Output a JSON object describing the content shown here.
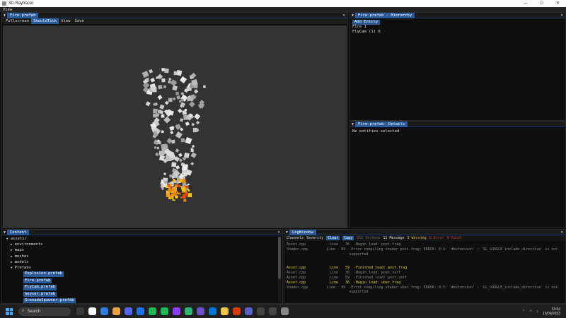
{
  "os": {
    "title": "3D Raytracer",
    "controls": [
      "—",
      "☐",
      "✕"
    ]
  },
  "menubar": {
    "items": [
      "View"
    ]
  },
  "viewport": {
    "tab": "Fire.prefab",
    "toolbar": [
      "Fullscreen",
      "ShouldTick",
      "View",
      "Save"
    ],
    "active_toolbar_index": 1
  },
  "hierarchy": {
    "tab": "Fire.prefab - Hierarchy",
    "add_button": "Add Entity",
    "entities": [
      "Fire 1",
      "FlyCam (1) 0"
    ]
  },
  "details": {
    "tab": "Fire.prefab- Details",
    "message": "No entities selected"
  },
  "content": {
    "tab": "Content",
    "tree": [
      {
        "label": "assets/",
        "arrow": "▼",
        "indent": 0
      },
      {
        "label": "environments",
        "arrow": "▶",
        "indent": 1
      },
      {
        "label": "maps",
        "arrow": "▶",
        "indent": 1
      },
      {
        "label": "meshes",
        "arrow": "▶",
        "indent": 1
      },
      {
        "label": "models",
        "arrow": "▶",
        "indent": 1
      },
      {
        "label": "Prefabs",
        "arrow": "▼",
        "indent": 1
      }
    ],
    "prefabs": [
      "Explosion.prefab",
      "Fire.prefab",
      "FlyCam.prefab",
      "Geyser.prefab",
      "GrenadeSpawner.prefab"
    ],
    "trailing": {
      "label": "shaders",
      "arrow": "▶"
    }
  },
  "log": {
    "tab": "LogWindow",
    "toolbar": {
      "channels": "Channels",
      "severity": "Severity",
      "clear": "Clear",
      "copy": "Copy",
      "verbose": "932 Verbose",
      "message": "11 Message",
      "warning": "5 Warning",
      "error": "8 Error",
      "fatal": "0 Fatal"
    },
    "lines": [
      {
        "src": "Asset.cpp",
        "ln": "Line",
        "no": "36",
        "msg": "-Begin load: post.frag",
        "color": "gray"
      },
      {
        "src": "Shader.cpp",
        "ln": "Line",
        "no": "89",
        "msg": "-Error compiling shader post.frag: ERROR: 0:3: '#extension' : 'GL_GOOGLE_include_directive' is not supported",
        "color": "gray"
      },
      {
        "spacer": true
      },
      {
        "src": "Asset.cpp",
        "ln": "Line",
        "no": "59",
        "msg": "-Finished load: post.frag",
        "color": "yellow"
      },
      {
        "src": "Asset.cpp",
        "ln": "Line",
        "no": "36",
        "msg": "-Begin load: post.vert",
        "color": "gray"
      },
      {
        "src": "Asset.cpp",
        "ln": "Line",
        "no": "59",
        "msg": "-Finished load: post.vert",
        "color": "gray"
      },
      {
        "src": "Asset.cpp",
        "ln": "Line",
        "no": "36",
        "msg": "-Begin load: uber.frag",
        "color": "yellow"
      },
      {
        "src": "Shader.cpp",
        "ln": "Line",
        "no": "89",
        "msg": "-Error compiling shader uber.frag: ERROR: 0:3: '#extension' : 'GL_GOOGLE_include_directive' is not supported",
        "color": "gray"
      }
    ]
  },
  "taskbar": {
    "search": "Search",
    "time": "13:34",
    "date": "15/09/2023",
    "app_icons": [
      "#3a3a3a",
      "#ffffff",
      "#2f7be0",
      "#e8a33d",
      "#5865f2",
      "#1a73e8",
      "#1db954",
      "#1db954",
      "#8a3ffc",
      "#2bb673",
      "#6f4ec7",
      "#0078d4",
      "#f4c542",
      "#d83b01",
      "#5b5fc7",
      "#444444",
      "#444444",
      "#888888"
    ]
  },
  "colors": {
    "accent": "#2a5a99",
    "viewport_bg": "#333333",
    "panel_bg": "#0f0f0f",
    "warning": "#d9c341",
    "error": "#b83a3a"
  }
}
